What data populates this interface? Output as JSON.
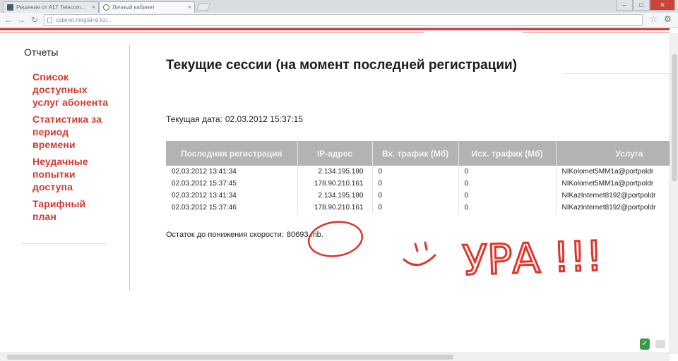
{
  "browser": {
    "tabs": [
      {
        "label": "Решение от ALT Telecom..."
      },
      {
        "label": "Личный кабинет"
      }
    ],
    "address": "cabinet.megaline.kz/...",
    "colors": {
      "accent": "#d93a34"
    }
  },
  "sidebar": {
    "title": "Отчеты",
    "items": [
      {
        "label": "Список доступных услуг абонента"
      },
      {
        "label": "Статистика за период времени"
      },
      {
        "label": "Неудачные попытки доступа"
      },
      {
        "label": "Тарифный план"
      }
    ]
  },
  "main": {
    "title": "Текущие сессии (на момент последней регистрации)",
    "current_date_label": "Текущая дата:",
    "current_date_value": "02.03.2012 15:37:15",
    "table": {
      "headers": [
        "Последняя регистрация",
        "IP-адрес",
        "Вх. трафик (Мб)",
        "Исх. трафик (Мб)",
        "Услуга"
      ],
      "rows": [
        [
          "02.03.2012 13:41:34",
          "2.134.195.180",
          "0",
          "0",
          "NIKolomet5MM1a@portpoldr"
        ],
        [
          "02.03.2012 15:37:45",
          "178.90.210.161",
          "0",
          "0",
          "NIKolomet5MM1a@portpoldr"
        ],
        [
          "02.03.2012 13:41:34",
          "2.134.195.180",
          "0",
          "0",
          "NIKazInternet8192@portpoldr"
        ],
        [
          "02.03.2012 15:37:46",
          "178.90.210.161",
          "0",
          "0",
          "NIKazInternet8192@portpoldr"
        ]
      ]
    },
    "remaining_label": "Остаток до понижения скорости:",
    "remaining_value": "80693 mb."
  },
  "annotation": {
    "text": "УРА !!!",
    "color": "#e0332a"
  }
}
